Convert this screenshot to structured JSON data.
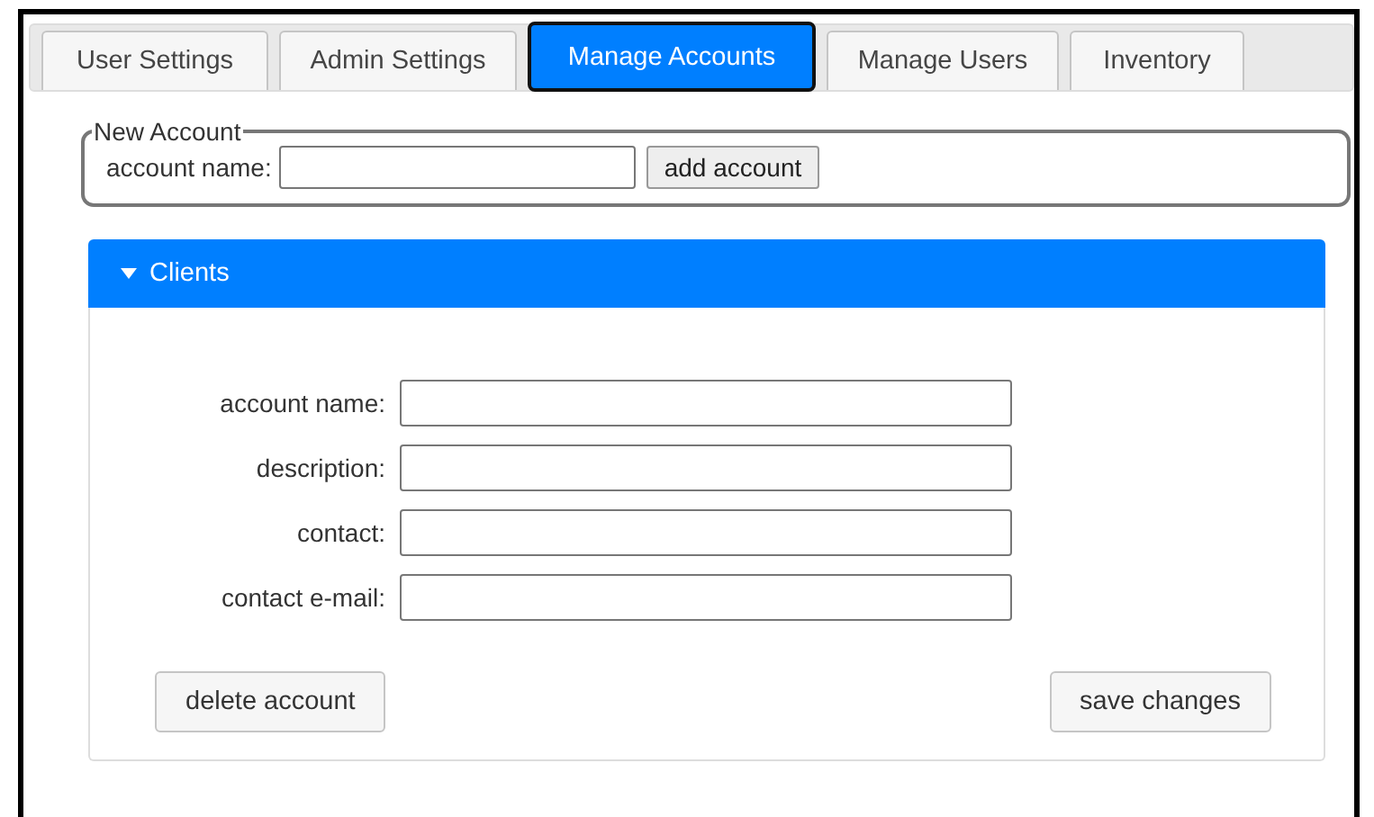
{
  "tabs": [
    {
      "label": "User Settings",
      "selected": false
    },
    {
      "label": "Admin Settings",
      "selected": false
    },
    {
      "label": "Manage Accounts",
      "selected": true
    },
    {
      "label": "Manage Users",
      "selected": false
    },
    {
      "label": "Inventory",
      "selected": false
    }
  ],
  "new_account": {
    "legend": "New Account",
    "label": "account name:",
    "button": "add account"
  },
  "panel": {
    "title": "Clients",
    "expanded": true,
    "fields": [
      {
        "label": "account name:"
      },
      {
        "label": "description:"
      },
      {
        "label": "contact:"
      },
      {
        "label": "contact e-mail:"
      }
    ],
    "buttons": [
      "delete account",
      "save changes"
    ]
  }
}
